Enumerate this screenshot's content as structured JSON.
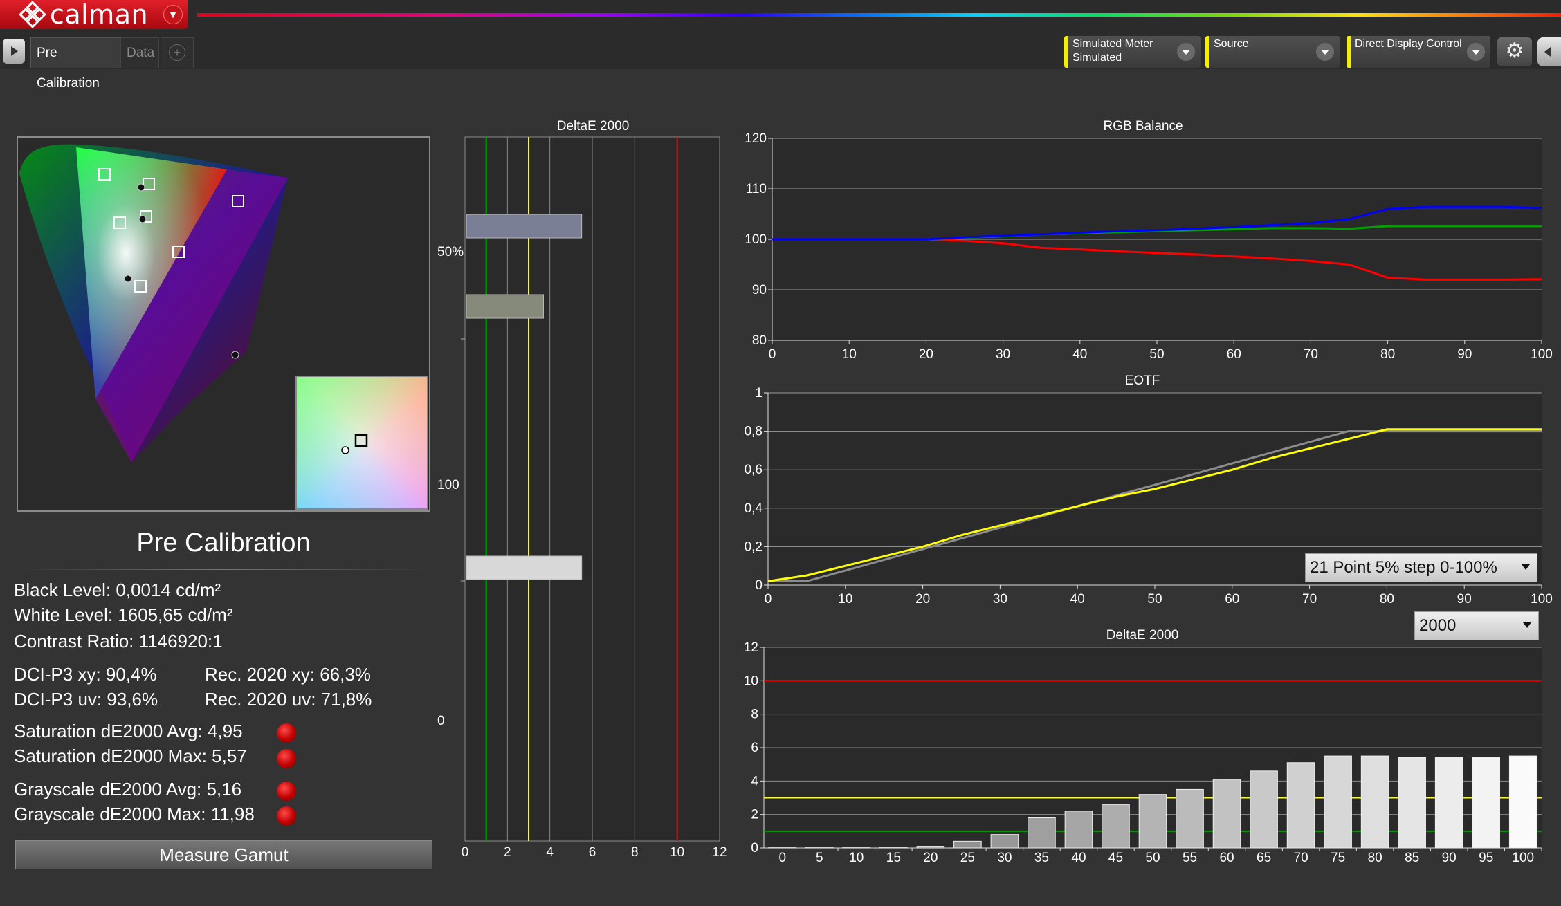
{
  "app": {
    "logo_text": "calman"
  },
  "tabs": [
    {
      "label": "Pre Calibration",
      "active": true
    },
    {
      "label": "Data",
      "active": false
    },
    {
      "label": "+",
      "active": false
    }
  ],
  "devices": {
    "meter": {
      "line1": "Simulated Meter",
      "line2": "Simulated"
    },
    "source": {
      "line1": "Source",
      "line2": ""
    },
    "display": {
      "line1": "Direct Display Control",
      "line2": ""
    }
  },
  "colors": {
    "accent": "#f4ee00",
    "red": "#ff0000",
    "green": "#00b000",
    "blue": "#0000ff",
    "yellow": "#ffff00"
  },
  "summary": {
    "title": "Pre Calibration",
    "black_level": "Black Level: 0,0014 cd/m²",
    "white_level": "White Level: 1605,65 cd/m²",
    "contrast": "Contrast Ratio: 1146920:1",
    "dci_xy": "DCI-P3 xy: 90,4%",
    "dci_uv": "DCI-P3 uv: 93,6%",
    "rec_xy": "Rec. 2020 xy: 66,3%",
    "rec_uv": "Rec. 2020 uv: 71,8%",
    "sat_avg": "Saturation dE2000 Avg: 4,95",
    "sat_max": "Saturation dE2000 Max: 5,57",
    "gray_avg": "Grayscale dE2000 Avg: 5,16",
    "gray_max": "Grayscale dE2000 Max: 11,98",
    "status_icon": "red-status-dot"
  },
  "measure_button": "Measure Gamut",
  "eotf_select": "21 Point 5% step 0-100%",
  "de_select": "2000",
  "chart_data": [
    {
      "id": "delta_vert",
      "type": "bar",
      "title": "DeltaE 2000",
      "x_ticks": [
        "0",
        "2",
        "4",
        "6",
        "8",
        "10",
        "12"
      ],
      "y_labels": [
        "50%",
        "100",
        "0"
      ],
      "xlim": [
        0,
        12
      ],
      "thresholds": {
        "green": 1,
        "yellow": 3,
        "red": 10
      },
      "bars": [
        {
          "value": 5.5,
          "color": "#7b7f95"
        },
        {
          "value": 3.7,
          "color": "#868a7a"
        },
        {
          "value": 5.5,
          "color": "#d8d8d8"
        }
      ]
    },
    {
      "id": "rgb_balance",
      "type": "line",
      "title": "RGB Balance",
      "ylim": [
        80,
        120
      ],
      "y_ticks": [
        "80",
        "90",
        "100",
        "110",
        "120"
      ],
      "x_ticks": [
        "0",
        "10",
        "20",
        "30",
        "40",
        "50",
        "60",
        "70",
        "80",
        "90",
        "100"
      ],
      "x": [
        0,
        5,
        10,
        15,
        20,
        25,
        30,
        35,
        40,
        45,
        50,
        55,
        60,
        65,
        70,
        75,
        80,
        85,
        90,
        95,
        100
      ],
      "series": [
        {
          "color": "#ff0000",
          "values": [
            100,
            100,
            100,
            100,
            100,
            99.7,
            99.2,
            98.3,
            98,
            97.6,
            97.3,
            97,
            96.6,
            96.2,
            95.7,
            95,
            92.4,
            92,
            92,
            92,
            92.1
          ]
        },
        {
          "color": "#00a000",
          "values": [
            100,
            100,
            100,
            100,
            100,
            100.3,
            100.6,
            101,
            101.2,
            101.4,
            101.6,
            101.8,
            102,
            102.2,
            102.2,
            102.1,
            102.6,
            102.6,
            102.6,
            102.6,
            102.6
          ]
        },
        {
          "color": "#0000ff",
          "values": [
            100,
            100,
            100,
            100,
            100,
            100.4,
            100.7,
            101,
            101.3,
            101.6,
            101.8,
            102.1,
            102.4,
            102.8,
            103.2,
            104,
            106,
            106.4,
            106.4,
            106.4,
            106.2
          ]
        }
      ]
    },
    {
      "id": "eotf",
      "type": "line",
      "title": "EOTF",
      "ylim": [
        0,
        1
      ],
      "y_ticks": [
        "0",
        "0,2",
        "0,4",
        "0,6",
        "0,8",
        "1"
      ],
      "x_ticks": [
        "0",
        "10",
        "20",
        "30",
        "40",
        "50",
        "60",
        "70",
        "80",
        "90",
        "100"
      ],
      "series": [
        {
          "color": "#8c8c8c",
          "x": [
            0,
            5,
            75,
            80,
            100
          ],
          "values": [
            0.02,
            0.02,
            0.8,
            0.8,
            0.8
          ]
        },
        {
          "color": "#ffff00",
          "x": [
            0,
            5,
            10,
            15,
            20,
            25,
            30,
            35,
            40,
            45,
            50,
            55,
            60,
            65,
            70,
            75,
            80,
            85,
            90,
            95,
            100
          ],
          "values": [
            0.02,
            0.05,
            0.1,
            0.15,
            0.2,
            0.26,
            0.31,
            0.36,
            0.41,
            0.46,
            0.5,
            0.55,
            0.6,
            0.66,
            0.71,
            0.76,
            0.81,
            0.81,
            0.81,
            0.81,
            0.81
          ]
        }
      ]
    },
    {
      "id": "delta_grayscale",
      "type": "bar",
      "title": "DeltaE 2000",
      "ylim": [
        0,
        12
      ],
      "y_ticks": [
        "0",
        "2",
        "4",
        "6",
        "8",
        "10",
        "12"
      ],
      "categories": [
        "0",
        "5",
        "10",
        "15",
        "20",
        "25",
        "30",
        "35",
        "40",
        "45",
        "50",
        "55",
        "60",
        "65",
        "70",
        "75",
        "80",
        "85",
        "90",
        "95",
        "100"
      ],
      "values": [
        0.05,
        0.05,
        0.05,
        0.05,
        0.1,
        0.4,
        0.8,
        1.8,
        2.2,
        2.6,
        3.2,
        3.5,
        4.1,
        4.6,
        5.1,
        5.5,
        5.5,
        5.4,
        5.4,
        5.4,
        5.5
      ],
      "thresholds": {
        "green": 1,
        "yellow": 3,
        "red": 10
      }
    }
  ],
  "cie": {
    "targets": [
      [
        151,
        252
      ],
      [
        215,
        266
      ],
      [
        344,
        291
      ],
      [
        173,
        322
      ],
      [
        211,
        313
      ],
      [
        258,
        364
      ],
      [
        203,
        414
      ]
    ],
    "measured": [
      [
        204,
        271
      ],
      [
        206,
        317
      ],
      [
        185,
        403
      ],
      [
        340,
        513
      ]
    ],
    "inset_target": [
      522,
      637
    ],
    "inset_measured": [
      499,
      651
    ]
  }
}
